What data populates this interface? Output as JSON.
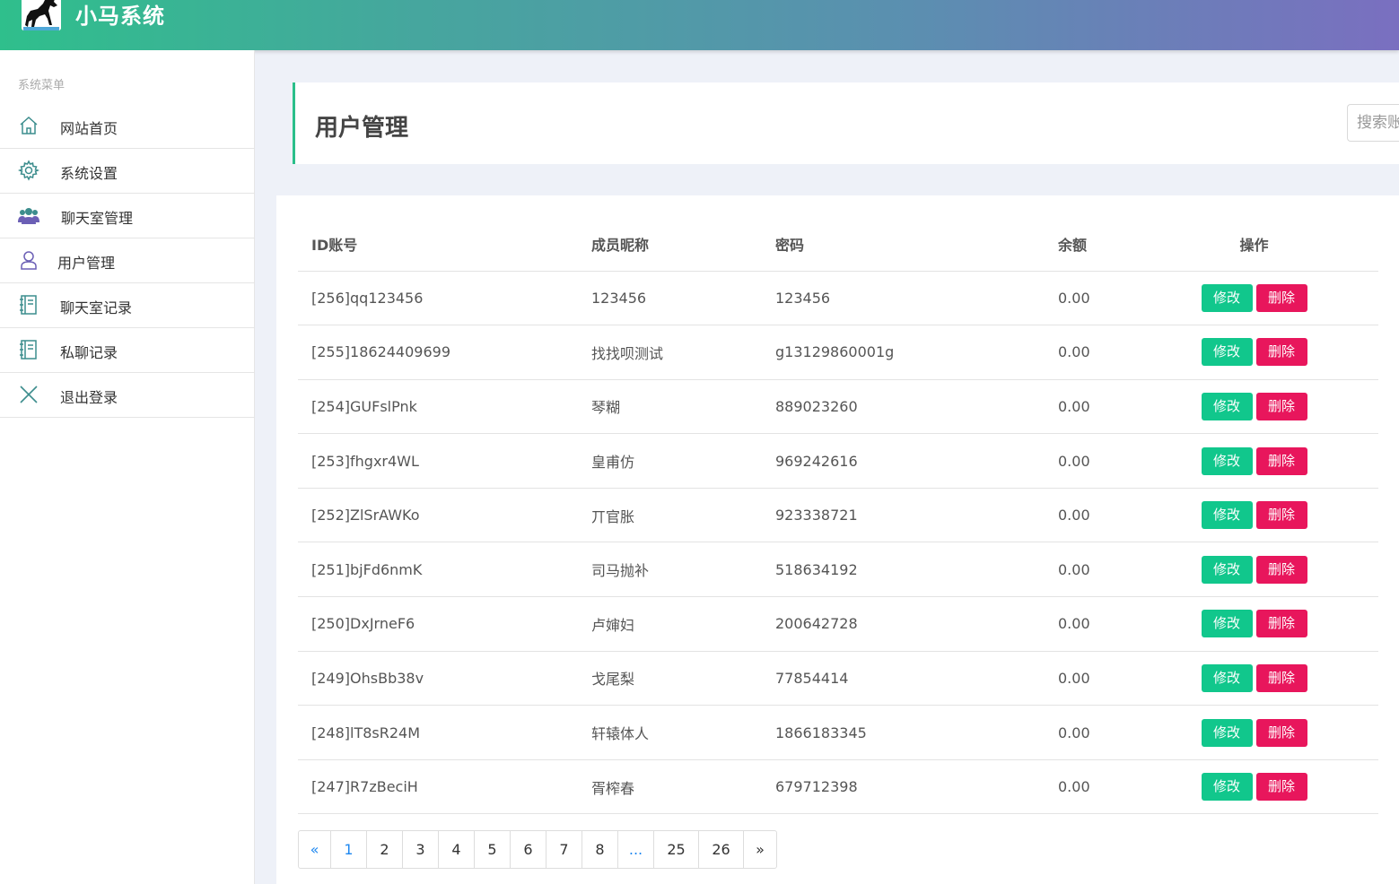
{
  "header": {
    "brand": "小马系统"
  },
  "sidebar": {
    "caption": "系统菜单",
    "items": [
      {
        "label": "网站首页",
        "icon": "home-icon"
      },
      {
        "label": "系统设置",
        "icon": "gear-icon"
      },
      {
        "label": "聊天室管理",
        "icon": "users-group-icon"
      },
      {
        "label": "用户管理",
        "icon": "user-icon"
      },
      {
        "label": "聊天室记录",
        "icon": "notebook-icon"
      },
      {
        "label": "私聊记录",
        "icon": "notebook-icon"
      },
      {
        "label": "退出登录",
        "icon": "close-icon"
      }
    ]
  },
  "main": {
    "title": "用户管理",
    "search_placeholder": "搜索账号"
  },
  "table": {
    "headers": [
      "ID账号",
      "成员昵称",
      "密码",
      "余额",
      "操作"
    ],
    "rows": [
      {
        "id": "[256]qq123456",
        "nickname": "123456",
        "password": "123456",
        "balance": "0.00"
      },
      {
        "id": "[255]18624409699",
        "nickname": "找找呗测试",
        "password": "g13129860001g",
        "balance": "0.00"
      },
      {
        "id": "[254]GUFslPnk",
        "nickname": "琴糊",
        "password": "889023260",
        "balance": "0.00"
      },
      {
        "id": "[253]fhgxr4WL",
        "nickname": "皇甫仿",
        "password": "969242616",
        "balance": "0.00"
      },
      {
        "id": "[252]ZlSrAWKo",
        "nickname": "丌官胀",
        "password": "923338721",
        "balance": "0.00"
      },
      {
        "id": "[251]bjFd6nmK",
        "nickname": "司马抛补",
        "password": "518634192",
        "balance": "0.00"
      },
      {
        "id": "[250]DxJrneF6",
        "nickname": "卢婶妇",
        "password": "200642728",
        "balance": "0.00"
      },
      {
        "id": "[249]OhsBb38v",
        "nickname": "戈尾梨",
        "password": "77854414",
        "balance": "0.00"
      },
      {
        "id": "[248]lT8sR24M",
        "nickname": "轩辕体人",
        "password": "1866183345",
        "balance": "0.00"
      },
      {
        "id": "[247]R7zBeciH",
        "nickname": "胥榨春",
        "password": "679712398",
        "balance": "0.00"
      }
    ],
    "edit_label": "修改",
    "delete_label": "删除"
  },
  "pagination": {
    "pages": [
      "«",
      "1",
      "2",
      "3",
      "4",
      "5",
      "6",
      "7",
      "8",
      "...",
      "25",
      "26",
      "»"
    ],
    "current": "1"
  },
  "colors": {
    "accent": "#2bbf8a",
    "edit_button": "#11c78c",
    "delete_button": "#e8165c",
    "link_blue": "#1e87f0"
  }
}
